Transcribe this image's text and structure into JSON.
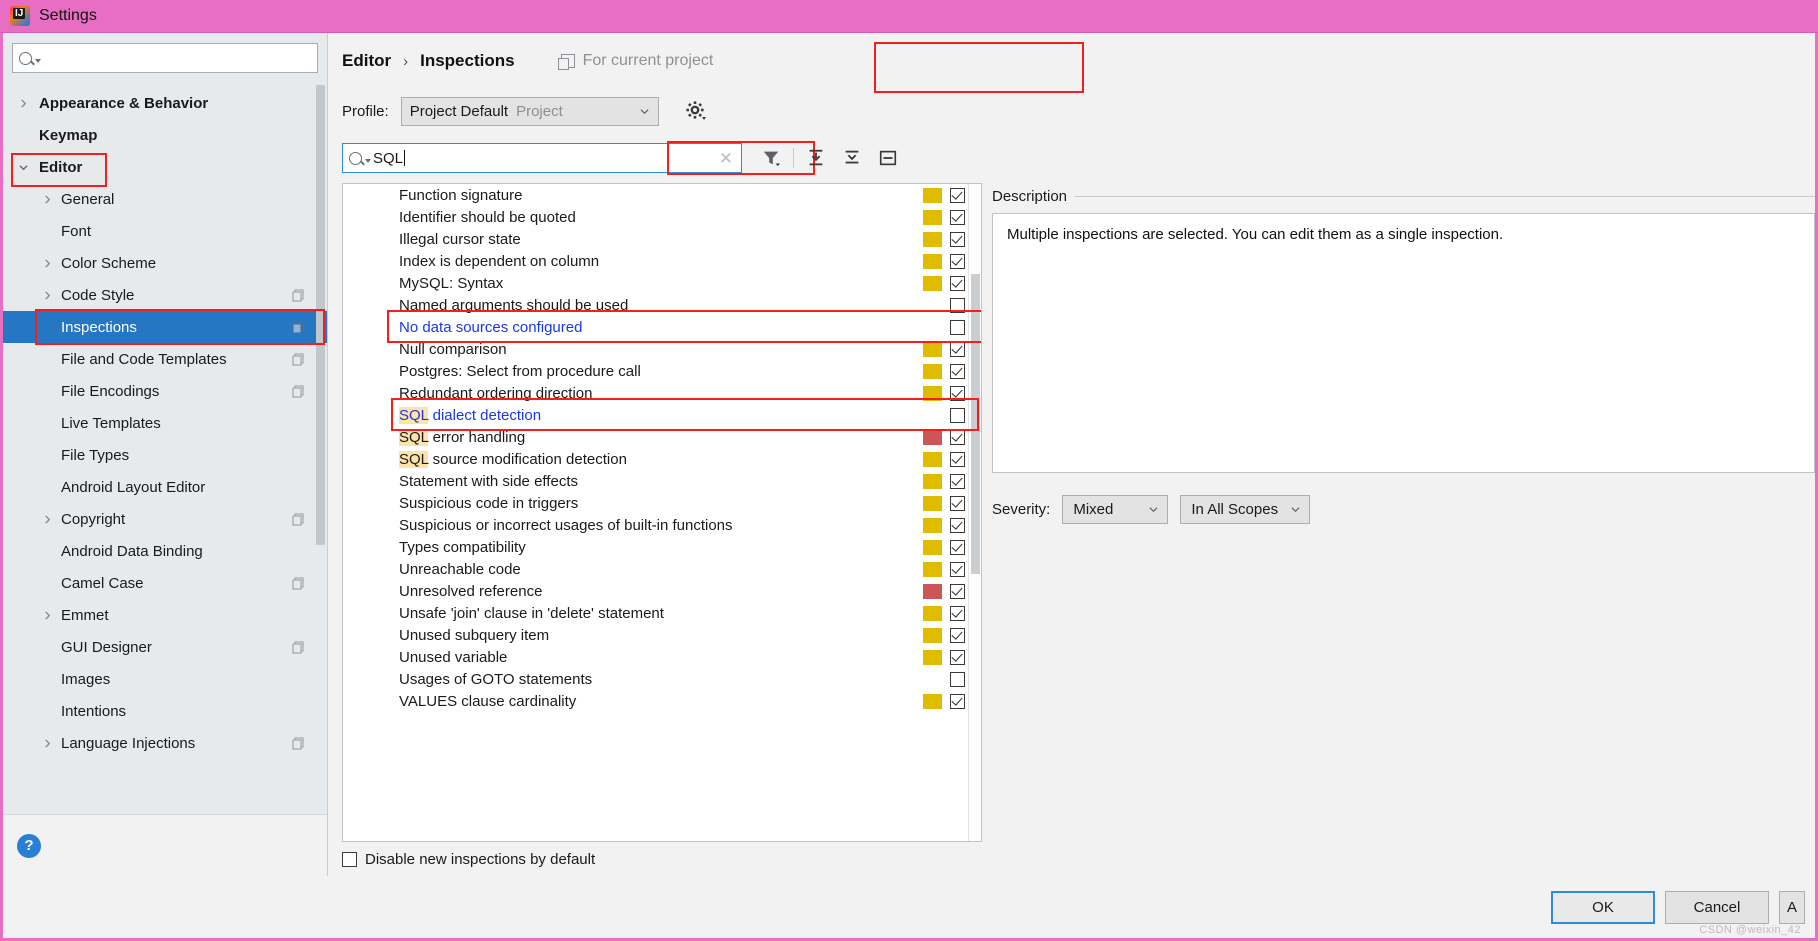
{
  "window": {
    "title": "Settings",
    "logo_icon": "intellij-idea-logo",
    "titlebar_color": "#e86ec4"
  },
  "sidebar": {
    "search": {
      "value": "",
      "placeholder": "",
      "icon": "search-icon"
    },
    "items": [
      {
        "label": "Appearance & Behavior",
        "level": 1,
        "arrow": "right",
        "bold": true,
        "selected": false,
        "badge": false
      },
      {
        "label": "Keymap",
        "level": 1,
        "arrow": "none",
        "bold": true,
        "selected": false,
        "badge": false
      },
      {
        "label": "Editor",
        "level": 1,
        "arrow": "down",
        "bold": true,
        "selected": false,
        "badge": false
      },
      {
        "label": "General",
        "level": 2,
        "arrow": "right",
        "bold": false,
        "selected": false,
        "badge": false
      },
      {
        "label": "Font",
        "level": 2,
        "arrow": "none",
        "bold": false,
        "selected": false,
        "badge": false
      },
      {
        "label": "Color Scheme",
        "level": 2,
        "arrow": "right",
        "bold": false,
        "selected": false,
        "badge": false
      },
      {
        "label": "Code Style",
        "level": 2,
        "arrow": "right",
        "bold": false,
        "selected": false,
        "badge": true
      },
      {
        "label": "Inspections",
        "level": 2,
        "arrow": "none",
        "bold": false,
        "selected": true,
        "badge": true
      },
      {
        "label": "File and Code Templates",
        "level": 2,
        "arrow": "none",
        "bold": false,
        "selected": false,
        "badge": true
      },
      {
        "label": "File Encodings",
        "level": 2,
        "arrow": "none",
        "bold": false,
        "selected": false,
        "badge": true
      },
      {
        "label": "Live Templates",
        "level": 2,
        "arrow": "none",
        "bold": false,
        "selected": false,
        "badge": false
      },
      {
        "label": "File Types",
        "level": 2,
        "arrow": "none",
        "bold": false,
        "selected": false,
        "badge": false
      },
      {
        "label": "Android Layout Editor",
        "level": 2,
        "arrow": "none",
        "bold": false,
        "selected": false,
        "badge": false
      },
      {
        "label": "Copyright",
        "level": 2,
        "arrow": "right",
        "bold": false,
        "selected": false,
        "badge": true
      },
      {
        "label": "Android Data Binding",
        "level": 2,
        "arrow": "none",
        "bold": false,
        "selected": false,
        "badge": false
      },
      {
        "label": "Camel Case",
        "level": 2,
        "arrow": "none",
        "bold": false,
        "selected": false,
        "badge": true
      },
      {
        "label": "Emmet",
        "level": 2,
        "arrow": "right",
        "bold": false,
        "selected": false,
        "badge": false
      },
      {
        "label": "GUI Designer",
        "level": 2,
        "arrow": "none",
        "bold": false,
        "selected": false,
        "badge": true
      },
      {
        "label": "Images",
        "level": 2,
        "arrow": "none",
        "bold": false,
        "selected": false,
        "badge": false
      },
      {
        "label": "Intentions",
        "level": 2,
        "arrow": "none",
        "bold": false,
        "selected": false,
        "badge": false
      },
      {
        "label": "Language Injections",
        "level": 2,
        "arrow": "right",
        "bold": false,
        "selected": false,
        "badge": true
      }
    ],
    "help_button": "?"
  },
  "header": {
    "breadcrumb": {
      "parent": "Editor",
      "separator": "›",
      "current": "Inspections"
    },
    "for_current_project": {
      "label": "For current project",
      "icon": "copy-icon"
    },
    "profile": {
      "label": "Profile:",
      "value": "Project Default",
      "scope": "Project",
      "caret_icon": "chevron-down-icon",
      "gear_icon": "gear-icon"
    }
  },
  "toolbar": {
    "filter_field": {
      "value": "SQL",
      "icon": "search-icon",
      "clear_icon": "clear-x-icon"
    },
    "buttons": [
      {
        "name": "filter-icon",
        "label": "Filter inspections"
      },
      {
        "name": "expand-all-icon",
        "label": "Expand all"
      },
      {
        "name": "collapse-all-icon",
        "label": "Collapse all"
      },
      {
        "name": "show-only-enabled-icon",
        "label": "Show only enabled"
      }
    ]
  },
  "inspections": {
    "rows": [
      {
        "label": "Function signature",
        "severity": "warning",
        "checked": true,
        "link": false,
        "match": ""
      },
      {
        "label": "Identifier should be quoted",
        "severity": "warning",
        "checked": true,
        "link": false,
        "match": ""
      },
      {
        "label": "Illegal cursor state",
        "severity": "warning",
        "checked": true,
        "link": false,
        "match": ""
      },
      {
        "label": "Index is dependent on column",
        "severity": "warning",
        "checked": true,
        "link": false,
        "match": ""
      },
      {
        "label": "MySQL: Syntax",
        "severity": "warning",
        "checked": true,
        "link": false,
        "match": ""
      },
      {
        "label": "Named arguments should be used",
        "severity": "none",
        "checked": false,
        "link": false,
        "match": ""
      },
      {
        "label": "No data sources configured",
        "severity": "none",
        "checked": false,
        "link": true,
        "match": ""
      },
      {
        "label": "Null comparison",
        "severity": "warning",
        "checked": true,
        "link": false,
        "match": ""
      },
      {
        "label": "Postgres: Select from procedure call",
        "severity": "warning",
        "checked": true,
        "link": false,
        "match": ""
      },
      {
        "label": "Redundant ordering direction",
        "severity": "warning",
        "checked": true,
        "link": false,
        "match": ""
      },
      {
        "label": "SQL dialect detection",
        "severity": "none",
        "checked": false,
        "link": true,
        "match": "SQL"
      },
      {
        "label": "SQL error handling",
        "severity": "error",
        "checked": true,
        "link": false,
        "match": "SQL"
      },
      {
        "label": "SQL source modification detection",
        "severity": "warning",
        "checked": true,
        "link": false,
        "match": "SQL"
      },
      {
        "label": "Statement with side effects",
        "severity": "warning",
        "checked": true,
        "link": false,
        "match": ""
      },
      {
        "label": "Suspicious code in triggers",
        "severity": "warning",
        "checked": true,
        "link": false,
        "match": ""
      },
      {
        "label": "Suspicious or incorrect usages of built-in functions",
        "severity": "warning",
        "checked": true,
        "link": false,
        "match": ""
      },
      {
        "label": "Types compatibility",
        "severity": "warning",
        "checked": true,
        "link": false,
        "match": ""
      },
      {
        "label": "Unreachable code",
        "severity": "warning",
        "checked": true,
        "link": false,
        "match": ""
      },
      {
        "label": "Unresolved reference",
        "severity": "error",
        "checked": true,
        "link": false,
        "match": ""
      },
      {
        "label": "Unsafe 'join' clause in 'delete' statement",
        "severity": "warning",
        "checked": true,
        "link": false,
        "match": ""
      },
      {
        "label": "Unused subquery item",
        "severity": "warning",
        "checked": true,
        "link": false,
        "match": ""
      },
      {
        "label": "Unused variable",
        "severity": "warning",
        "checked": true,
        "link": false,
        "match": ""
      },
      {
        "label": "Usages of GOTO statements",
        "severity": "none",
        "checked": false,
        "link": false,
        "match": ""
      },
      {
        "label": "VALUES clause cardinality",
        "severity": "warning",
        "checked": true,
        "link": false,
        "match": ""
      }
    ],
    "disable_new_label": "Disable new inspections by default",
    "disable_new_checked": false
  },
  "description": {
    "title": "Description",
    "body": "Multiple inspections are selected. You can edit them as a single inspection."
  },
  "severity": {
    "label": "Severity:",
    "value": "Mixed",
    "scope": "In All Scopes",
    "caret_icon": "chevron-down-icon"
  },
  "footer": {
    "ok": "OK",
    "cancel": "Cancel",
    "apply": "A"
  },
  "colors": {
    "warning": "#e0bc00",
    "error": "#cc5555",
    "accent": "#2577c4",
    "link": "#1a38e8",
    "match_highlight": "#fde3a7",
    "annotation": "#f31f1f"
  },
  "watermark": "CSDN @weixin_42"
}
